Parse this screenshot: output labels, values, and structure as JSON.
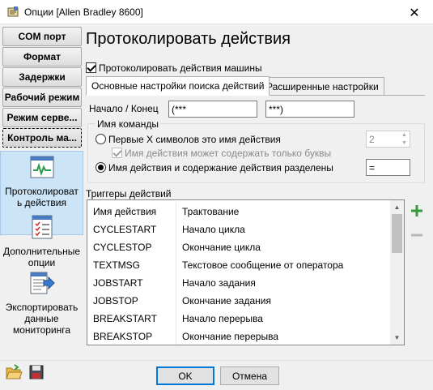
{
  "window": {
    "title": "Опции [Allen Bradley 8600]",
    "close_glyph": "✕"
  },
  "sidebar": {
    "buttons": [
      {
        "label": "COM порт"
      },
      {
        "label": "Формат"
      },
      {
        "label": "Задержки"
      },
      {
        "label": "Рабочий режим"
      },
      {
        "label": "Режим серве..."
      },
      {
        "label": "Контроль ма..."
      }
    ],
    "items": [
      {
        "label": "Протоколироват ь действия",
        "icon": "activity-log-icon"
      },
      {
        "label": "Дополнительные опции",
        "icon": "checklist-icon"
      },
      {
        "label": "Экспортировать данные мониторинга",
        "icon": "export-icon"
      }
    ]
  },
  "main": {
    "heading": "Протоколировать действия",
    "log_checkbox": {
      "label": "Протоколировать действия машины",
      "checked": true
    },
    "tabs": [
      {
        "label": "Основные настройки поиска действий",
        "active": true
      },
      {
        "label": "Расширенные настройки",
        "active": false
      }
    ],
    "start_end": {
      "label": "Начало / Конец",
      "start_value": "(***",
      "end_value": "***)"
    },
    "command_name": {
      "group_title": "Имя команды",
      "option1": {
        "label": "Первые X символов это имя действия",
        "value": "2"
      },
      "letters_only": {
        "label": "Имя действия может содержать только буквы"
      },
      "option2": {
        "label": "Имя действия и содержание действия разделены",
        "value": "="
      }
    },
    "triggers": {
      "title": "Триггеры действий",
      "columns": [
        "Имя действия",
        "Трактование"
      ],
      "rows": [
        [
          "CYCLESTART",
          "Начало цикла"
        ],
        [
          "CYCLESTOP",
          "Окончание цикла"
        ],
        [
          "TEXTMSG",
          "Текстовое сообщение от оператора"
        ],
        [
          "JOBSTART",
          "Начало задания"
        ],
        [
          "JOBSTOP",
          "Окончание задания"
        ],
        [
          "BREAKSTART",
          "Начало перерыва"
        ],
        [
          "BREAKSTOP",
          "Окончание перерыва"
        ]
      ],
      "add_icon": "plus-icon",
      "remove_icon": "minus-icon"
    }
  },
  "footer": {
    "ok_label": "OK",
    "cancel_label": "Отмена"
  },
  "colors": {
    "accent": "#0078d7",
    "add": "#3a9a3a",
    "selected_bg": "#cce4f7"
  }
}
